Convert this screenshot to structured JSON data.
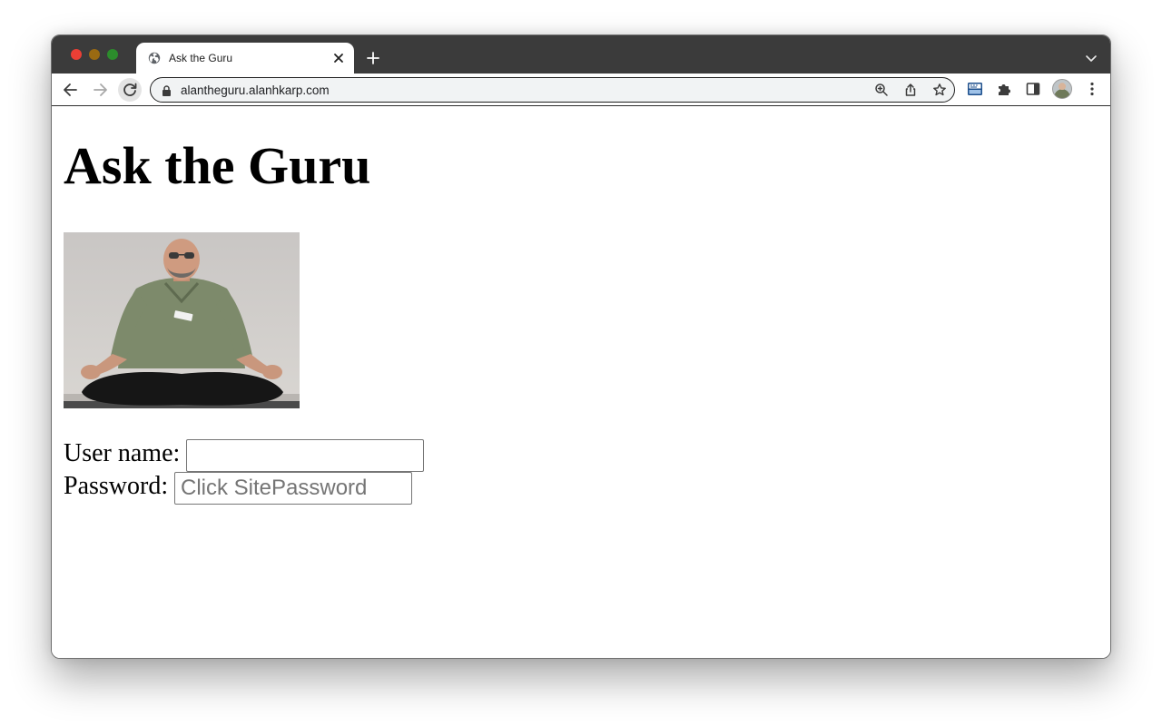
{
  "browser": {
    "tab": {
      "title": "Ask the Guru",
      "favicon": "globe-icon",
      "close": "close-icon"
    },
    "new_tab": "plus-icon",
    "tab_menu": "chevron-down-icon",
    "toolbar": {
      "back": "back-arrow-icon",
      "forward": "forward-arrow-icon",
      "reload": "reload-icon",
      "address": "alantheguru.alanhkarp.com",
      "lock": "lock-icon",
      "omnibox_icons": [
        "zoom-icon",
        "share-icon",
        "star-icon"
      ],
      "extensions": [
        "sitepassword-extension-icon",
        "puzzle-icon",
        "side-panel-icon"
      ],
      "profile": "avatar",
      "menu": "kebab-menu-icon"
    },
    "colors": {
      "tabstrip": "#3b3b3b",
      "close_red": "#ec3f35",
      "minimize_yellow": "#9a6a12",
      "zoom_green": "#2c8c2c"
    }
  },
  "page": {
    "heading": "Ask the Guru",
    "photo": "meditating-man-photo",
    "form": {
      "username_label": "User name:",
      "username_value": "",
      "password_label": "Password:",
      "password_placeholder": "Click SitePassword"
    }
  }
}
